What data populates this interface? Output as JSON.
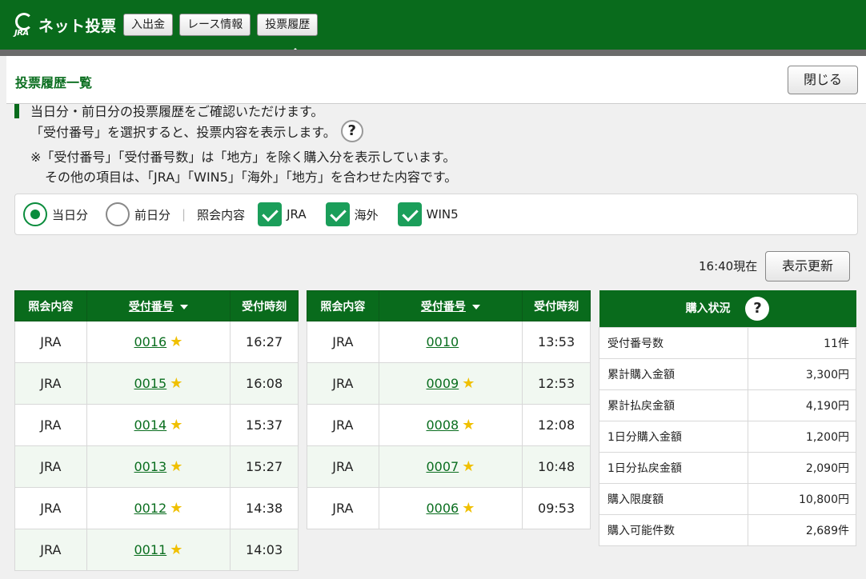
{
  "app": {
    "logo_sub": "JRA",
    "logo_title": "ネット投票"
  },
  "topnav": [
    "入出金",
    "レース情報",
    "投票履歴"
  ],
  "panel": {
    "title": "投票履歴一覧",
    "close_label": "閉じる"
  },
  "info": {
    "line1": "当日分・前日分の投票履歴をご確認いただけます。",
    "line2": "「受付番号」を選択すると、投票内容を表示します。",
    "line3": "※「受付番号」「受付番号数」は「地方」を除く購入分を表示しています。",
    "line4": "その他の項目は、「JRA」「WIN5」「海外」「地方」を合わせた内容です。",
    "help": "?"
  },
  "filter": {
    "radio_today": "当日分",
    "radio_prev": "前日分",
    "inquiry_label": "照会内容",
    "chk_jra": "JRA",
    "chk_overseas": "海外",
    "chk_win5": "WIN5",
    "selected": "当日分"
  },
  "refresh": {
    "now_text": "16:40現在",
    "button": "表示更新"
  },
  "history_headers": {
    "type": "照会内容",
    "number": "受付番号",
    "time": "受付時刻"
  },
  "history_left": [
    {
      "type": "JRA",
      "number": "0016",
      "star": true,
      "time": "16:27"
    },
    {
      "type": "JRA",
      "number": "0015",
      "star": true,
      "time": "16:08"
    },
    {
      "type": "JRA",
      "number": "0014",
      "star": true,
      "time": "15:37"
    },
    {
      "type": "JRA",
      "number": "0013",
      "star": true,
      "time": "15:27"
    },
    {
      "type": "JRA",
      "number": "0012",
      "star": true,
      "time": "14:38"
    },
    {
      "type": "JRA",
      "number": "0011",
      "star": true,
      "time": "14:03"
    }
  ],
  "history_right": [
    {
      "type": "JRA",
      "number": "0010",
      "star": false,
      "time": "13:53"
    },
    {
      "type": "JRA",
      "number": "0009",
      "star": true,
      "time": "12:53"
    },
    {
      "type": "JRA",
      "number": "0008",
      "star": true,
      "time": "12:08"
    },
    {
      "type": "JRA",
      "number": "0007",
      "star": true,
      "time": "10:48"
    },
    {
      "type": "JRA",
      "number": "0006",
      "star": true,
      "time": "09:53"
    }
  ],
  "status": {
    "title": "購入状況",
    "rows": [
      {
        "label": "受付番号数",
        "value": "11件"
      },
      {
        "label": "累計購入金額",
        "value": "3,300円"
      },
      {
        "label": "累計払戻金額",
        "value": "4,190円"
      },
      {
        "label": "1日分購入金額",
        "value": "1,200円"
      },
      {
        "label": "1日分払戻金額",
        "value": "2,090円"
      },
      {
        "label": "購入限度額",
        "value": "10,800円"
      },
      {
        "label": "購入可能件数",
        "value": "2,689件"
      }
    ]
  },
  "colors": {
    "brand_green": "#096b1c",
    "accent_green": "#1b9e5a",
    "star": "#f0c000"
  }
}
